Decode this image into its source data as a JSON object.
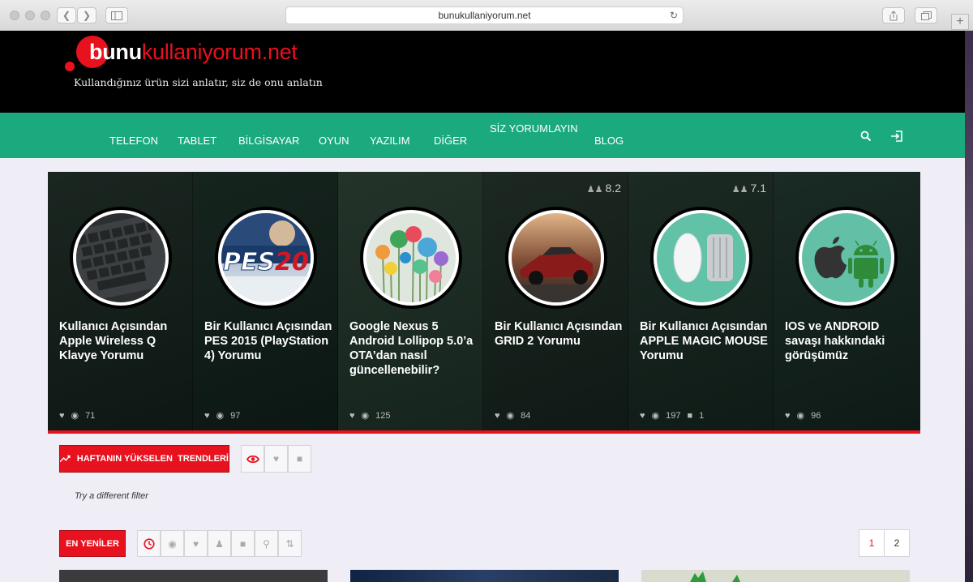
{
  "browser": {
    "url": "bunukullaniyorum.net"
  },
  "site": {
    "logo_bold": "bunu",
    "logo_light": "kullaniyorum.net",
    "tagline": "Kullandığınız ürün sizi anlatır, siz de onu anlatın",
    "brand_red": "#e8111e",
    "brand_green": "#1ba97e"
  },
  "nav": {
    "items": [
      "TELEFON",
      "TABLET",
      "BİLGİSAYAR",
      "OYUN",
      "YAZILIM",
      "DİĞER",
      "SİZ YORUMLAYIN",
      "BLOG"
    ]
  },
  "slider": {
    "cards": [
      {
        "title": "Kullanıcı Açısından Apple Wireless Q Klavye Yorumu",
        "views": "71",
        "score": "",
        "comments": ""
      },
      {
        "title": "Bir Kullanıcı Açısından PES 2015 (PlayStation 4) Yorumu",
        "views": "97",
        "score": "",
        "comments": ""
      },
      {
        "title": "Google Nexus 5 Android Lollipop 5.0’a OTA’dan nasıl güncellenebilir?",
        "views": "125",
        "score": "",
        "comments": ""
      },
      {
        "title": "Bir Kullanıcı Açısından GRID 2 Yorumu",
        "views": "84",
        "score": "8.2",
        "comments": ""
      },
      {
        "title": "Bir Kullanıcı Açısından APPLE MAGIC MOUSE Yorumu",
        "views": "197",
        "score": "7.1",
        "comments": "1"
      },
      {
        "title": "IOS ve ANDROID savaşı hakkındaki görüşümüz",
        "views": "96",
        "score": "",
        "comments": ""
      }
    ]
  },
  "trending": {
    "button_label": "HAFTANIN YÜKSELEN  TRENDLERİ",
    "empty_text": "Try a different filter"
  },
  "latest": {
    "button_label": "EN YENİLER",
    "pages": [
      "1",
      "2"
    ]
  }
}
